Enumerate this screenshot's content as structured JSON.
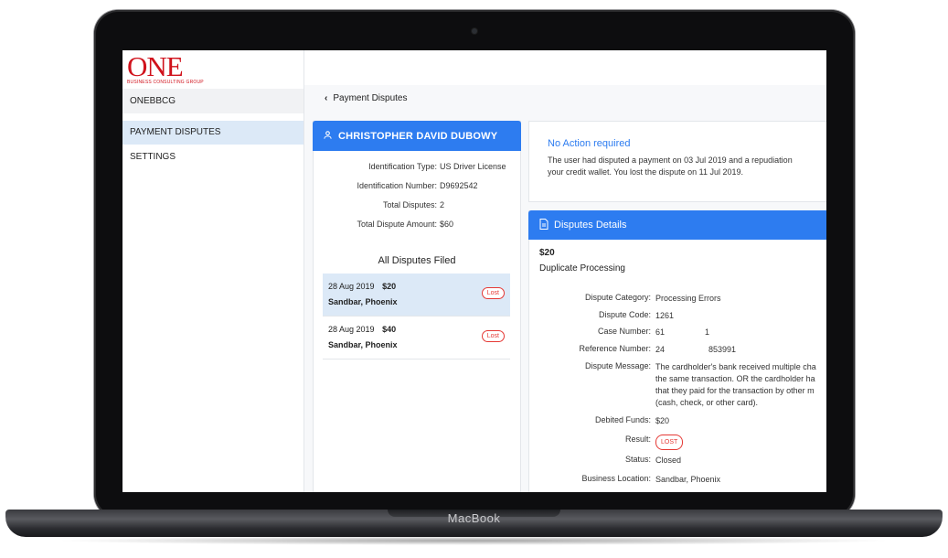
{
  "device": {
    "brand": "MacBook"
  },
  "brand": {
    "logo_text": "ONE",
    "logo_subtitle": "BUSINESS CONSULTING GROUP"
  },
  "sidebar": {
    "org_name": "ONEBBCG",
    "items": [
      {
        "label": "PAYMENT DISPUTES",
        "active": true
      },
      {
        "label": "SETTINGS",
        "active": false
      }
    ]
  },
  "breadcrumb": {
    "back_label": "Payment Disputes"
  },
  "profile": {
    "name": "CHRISTOPHER DAVID DUBOWY",
    "fields": [
      {
        "label": "Identification Type:",
        "value": "US Driver License"
      },
      {
        "label": "Identification Number:",
        "value": "D9692542"
      },
      {
        "label": "Total Disputes:",
        "value": "2"
      },
      {
        "label": "Total Dispute Amount:",
        "value": "$60"
      }
    ],
    "disputes_title": "All Disputes Filed",
    "disputes": [
      {
        "date": "28 Aug 2019",
        "amount": "$20",
        "merchant": "Sandbar, Phoenix",
        "status": "Lost",
        "selected": true
      },
      {
        "date": "28 Aug 2019",
        "amount": "$40",
        "merchant": "Sandbar, Phoenix",
        "status": "Lost",
        "selected": false
      }
    ]
  },
  "action": {
    "title": "No Action required",
    "line1": "The user had disputed a payment on 03 Jul 2019 and a repudiation",
    "line2": "your credit wallet. You lost the dispute on 11 Jul 2019."
  },
  "details": {
    "title": "Disputes Details",
    "amount": "$20",
    "type": "Duplicate Processing",
    "rows": [
      {
        "label": "Dispute Category:",
        "value": "Processing Errors"
      },
      {
        "label": "Dispute Code:",
        "value": "1261"
      },
      {
        "label": "Case Number:",
        "value_a": "61",
        "value_b": "1"
      },
      {
        "label": "Reference Number:",
        "value_a": "24",
        "value_b": "853991"
      },
      {
        "label": "Dispute Message:",
        "lines": [
          "The cardholder's bank received multiple cha",
          "the same transaction. OR the cardholder ha",
          "that they paid for the transaction by other m",
          "(cash, check, or other card)."
        ]
      },
      {
        "label": "Debited Funds:",
        "value": "$20"
      },
      {
        "label": "Result:",
        "value": "LOST"
      },
      {
        "label": "Status:",
        "value": "Closed"
      },
      {
        "label": "Business Location:",
        "value": "Sandbar, Phoenix"
      }
    ]
  },
  "colors": {
    "primary": "#2d7cf0",
    "danger": "#e53935",
    "brand_red": "#d0121c",
    "active_nav": "#dce9f7"
  }
}
